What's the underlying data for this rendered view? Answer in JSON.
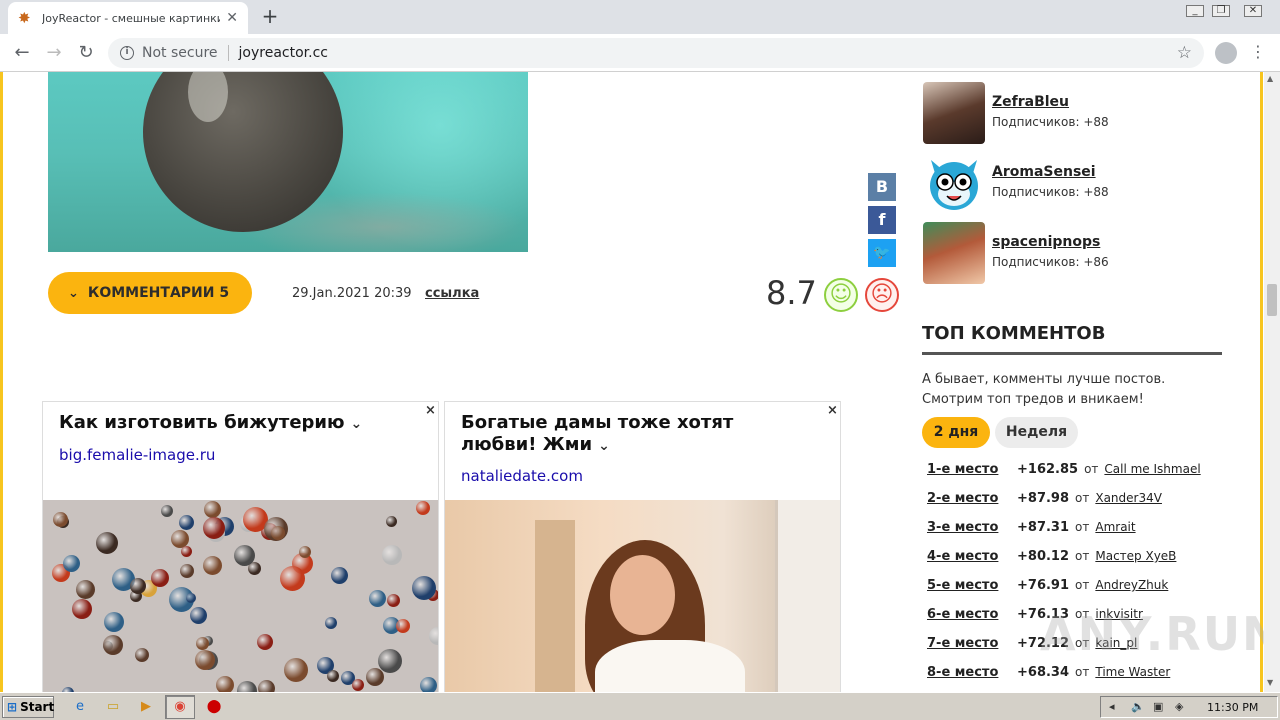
{
  "browser": {
    "tab_title": "JoyReactor - смешные картинки и",
    "tab_close": "✕",
    "new_tab": "+",
    "not_secure": "Not secure",
    "url": "joyreactor.cc"
  },
  "post": {
    "comments_label": "КОММЕНТАРИИ 5",
    "date": "29.Jan.2021 20:39",
    "link_label": "ссылка",
    "rating": "8.7",
    "share": {
      "vk": "В",
      "fb": "f",
      "tw": "🐦"
    }
  },
  "ads": [
    {
      "title": "Как изготовить бижутерию",
      "domain": "big.femalie-image.ru",
      "close": "×"
    },
    {
      "title": "Богатые дамы тоже хотят любви! Жми",
      "domain": "nataliedate.com",
      "close": "×"
    }
  ],
  "sidebar": {
    "users": [
      {
        "name": "ZefraBleu",
        "subs": "Подписчиков: +88"
      },
      {
        "name": "AromaSensei",
        "subs": "Подписчиков: +88"
      },
      {
        "name": "spacenipnops",
        "subs": "Подписчиков: +86"
      }
    ],
    "top_heading": "ТОП КОММЕНТОВ",
    "top_desc": "А бывает, комменты лучше постов. Смотрим топ тредов и вникаем!",
    "tab_active": "2 дня",
    "tab_inactive": "Неделя",
    "ot_label": "от",
    "top": [
      {
        "place": "1-е место",
        "score": "+162.85",
        "author": "Call me Ishmael"
      },
      {
        "place": "2-е место",
        "score": "+87.98",
        "author": "Xander34V"
      },
      {
        "place": "3-е место",
        "score": "+87.31",
        "author": "Amrait"
      },
      {
        "place": "4-е место",
        "score": "+80.12",
        "author": "Мастер ХуеВ"
      },
      {
        "place": "5-е место",
        "score": "+76.91",
        "author": "AndreyZhuk"
      },
      {
        "place": "6-е место",
        "score": "+76.13",
        "author": "inkvisitr"
      },
      {
        "place": "7-е место",
        "score": "+72.12",
        "author": "kain_pl"
      },
      {
        "place": "8-е место",
        "score": "+68.34",
        "author": "Time Waster"
      }
    ]
  },
  "watermark": "ANY.RUN",
  "taskbar": {
    "start": "Start",
    "clock": "11:30 PM"
  },
  "colors": {
    "accent": "#fbb40f",
    "border": "#f7c51f",
    "good": "#8dcf3f",
    "bad": "#e5473b"
  }
}
